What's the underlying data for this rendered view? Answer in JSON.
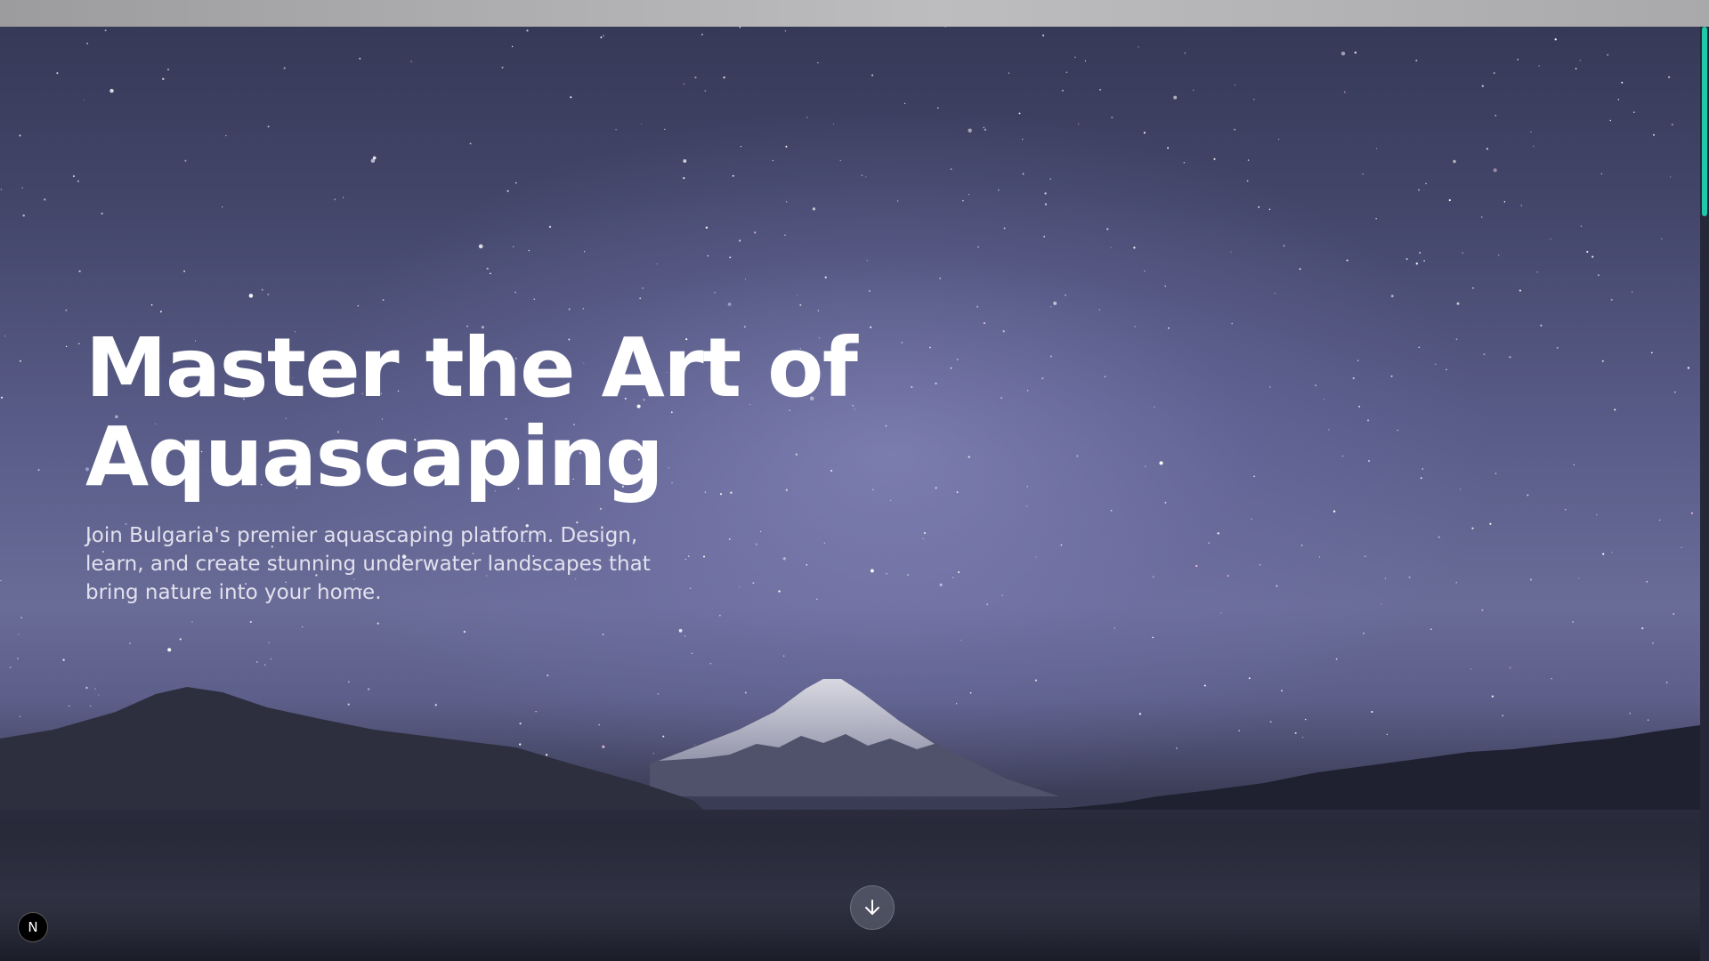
{
  "hero": {
    "title_line1": "Master the Art of",
    "title_line2": "Aquascaping",
    "subtitle": "Join Bulgaria's premier aquascaping platform. Design, learn, and create stunning underwater landscapes that bring nature into your home."
  },
  "scroll_button": {
    "icon": "arrow-down-icon"
  },
  "dev_badge": {
    "label": "N",
    "icon": "nextjs-logo-icon"
  },
  "colors": {
    "accent": "#1ec8a8",
    "sky_top": "#363957",
    "sky_mid": "#6a6c98",
    "title_text": "#ffffff"
  }
}
